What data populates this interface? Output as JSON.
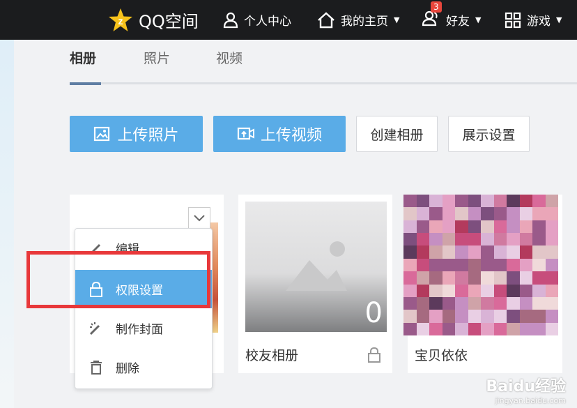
{
  "topbar": {
    "logo_text": "QQ空间",
    "nav": [
      {
        "label": "个人中心",
        "icon": "person-icon"
      },
      {
        "label": "我的主页",
        "icon": "home-icon"
      },
      {
        "label": "好友",
        "icon": "friends-icon",
        "badge": "3"
      },
      {
        "label": "游戏",
        "icon": "games-grid-icon"
      }
    ]
  },
  "tabs": [
    "相册",
    "照片",
    "视频"
  ],
  "actions": {
    "upload_photo": "上传照片",
    "upload_video": "上传视频",
    "create_album": "创建相册",
    "display_settings": "展示设置"
  },
  "albums": [
    {
      "title": "",
      "count": ""
    },
    {
      "title": "校友相册",
      "count": "0"
    },
    {
      "title": "宝贝依依",
      "count": ""
    }
  ],
  "dropdown": {
    "items": [
      {
        "label": "编辑",
        "icon": "pencil-icon"
      },
      {
        "label": "权限设置",
        "icon": "lock-icon",
        "active": true
      },
      {
        "label": "制作封面",
        "icon": "magic-wand-icon"
      },
      {
        "label": "删除",
        "icon": "trash-icon"
      }
    ]
  },
  "watermark": {
    "brand": "Baidu经验",
    "url": "jingyan.baidu.com"
  },
  "colors": {
    "topbar": "#1b1c1e",
    "accent_blue": "#5aace7",
    "highlight_red": "#e8383a",
    "badge_red": "#e8463c"
  }
}
